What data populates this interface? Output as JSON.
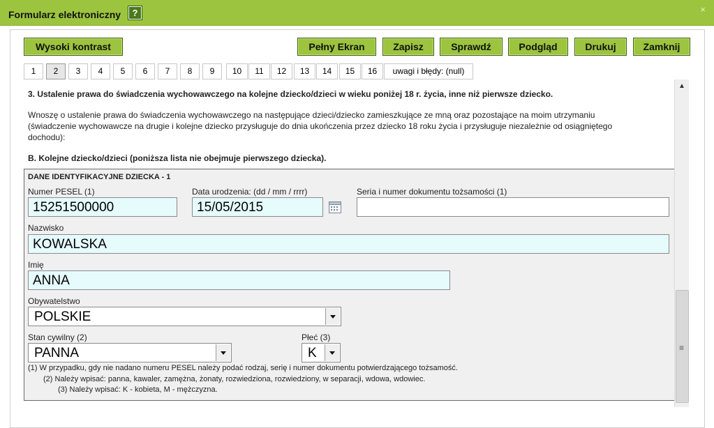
{
  "window": {
    "title": "Formularz elektroniczny",
    "help_glyph": "?",
    "close_glyph": "×"
  },
  "toolbar": {
    "high_contrast": "Wysoki kontrast",
    "fullscreen": "Pełny Ekran",
    "save": "Zapisz",
    "check": "Sprawdź",
    "preview": "Podgląd",
    "print": "Drukuj",
    "close": "Zamknij"
  },
  "tabs": [
    "1",
    "2",
    "3",
    "4",
    "5",
    "6",
    "7",
    "8",
    "9",
    "10",
    "11",
    "12",
    "13",
    "14",
    "15",
    "16",
    "uwagi i błędy: (null)"
  ],
  "active_tab": "2",
  "section": {
    "heading": "3. Ustalenie prawa do świadczenia wychowawczego na kolejne dziecko/dzieci w wieku poniżej 18 r. życia, inne niż pierwsze dziecko.",
    "para1": "Wnoszę o ustalenie prawa do świadczenia wychowawczego na następujące dzieci/dziecko zamieszkujące ze mną oraz pozostające na moim utrzymaniu",
    "para2": "(świadczenie wychowawcze na drugie i kolejne dziecko przysługuje do dnia ukończenia przez dziecko 18 roku życia i przysługuje niezależnie od osiągniętego",
    "para3": "dochodu):",
    "subheading": "B. Kolejne dziecko/dzieci (poniższa lista nie obejmuje pierwszego dziecka)."
  },
  "child": {
    "box_title": "DANE IDENTYFIKACYJNE DZIECKA - 1",
    "pesel_label": "Numer PESEL (1)",
    "pesel_value": "15251500000",
    "dob_label": "Data urodzenia: (dd / mm / rrrr)",
    "dob_value": "15/05/2015",
    "doc_label": "Seria i numer dokumentu tożsamości (1)",
    "doc_value": "",
    "surname_label": "Nazwisko",
    "surname_value": "KOWALSKA",
    "name_label": "Imię",
    "name_value": "ANNA",
    "citizenship_label": "Obywatelstwo",
    "citizenship_value": "POLSKIE",
    "marital_label": "Stan cywilny (2)",
    "marital_value": "PANNA",
    "sex_label": "Płeć (3)",
    "sex_value": "K"
  },
  "notes": {
    "n1": "(1)  W przypadku, gdy nie nadano numeru PESEL należy podać rodzaj, serię i numer dokumentu potwierdzającego tożsamość.",
    "n2": "(2)  Należy wpisać: panna, kawaler, zamężna, żonaty, rozwiedziona, rozwiedziony, w separacji, wdowa, wdowiec.",
    "n3": "(3)  Należy wpisać: K - kobieta, M - mężczyzna."
  },
  "scrollbar": {
    "up_glyph": "▲",
    "grip_glyph": "≡"
  }
}
